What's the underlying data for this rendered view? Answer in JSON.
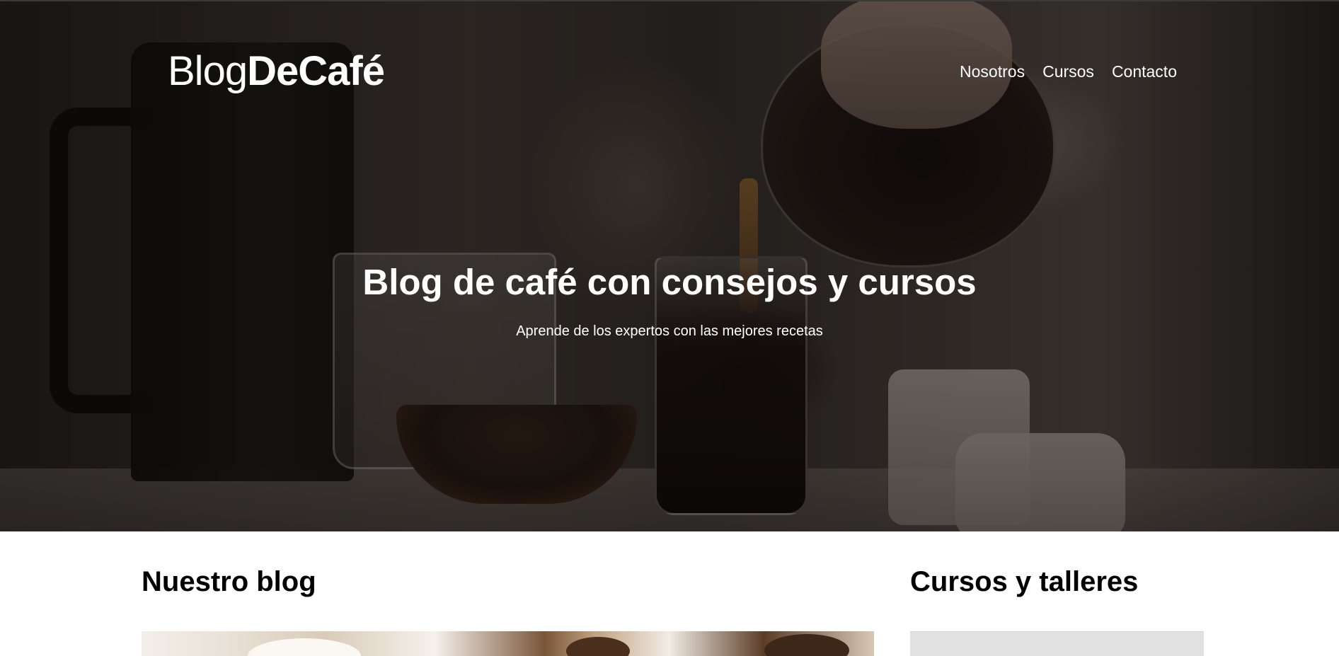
{
  "header": {
    "brand_light": "Blog",
    "brand_bold": "DeCafé",
    "nav": [
      {
        "label": "Nosotros"
      },
      {
        "label": "Cursos"
      },
      {
        "label": "Contacto"
      }
    ]
  },
  "hero": {
    "title": "Blog de café con consejos y cursos",
    "subtitle": "Aprende de los expertos con las mejores recetas"
  },
  "main": {
    "blog_heading": "Nuestro blog",
    "courses_heading": "Cursos y talleres"
  },
  "colors": {
    "hero_text": "#ffffff",
    "heading_text": "#000000",
    "card_placeholder": "#e1e1e1"
  }
}
